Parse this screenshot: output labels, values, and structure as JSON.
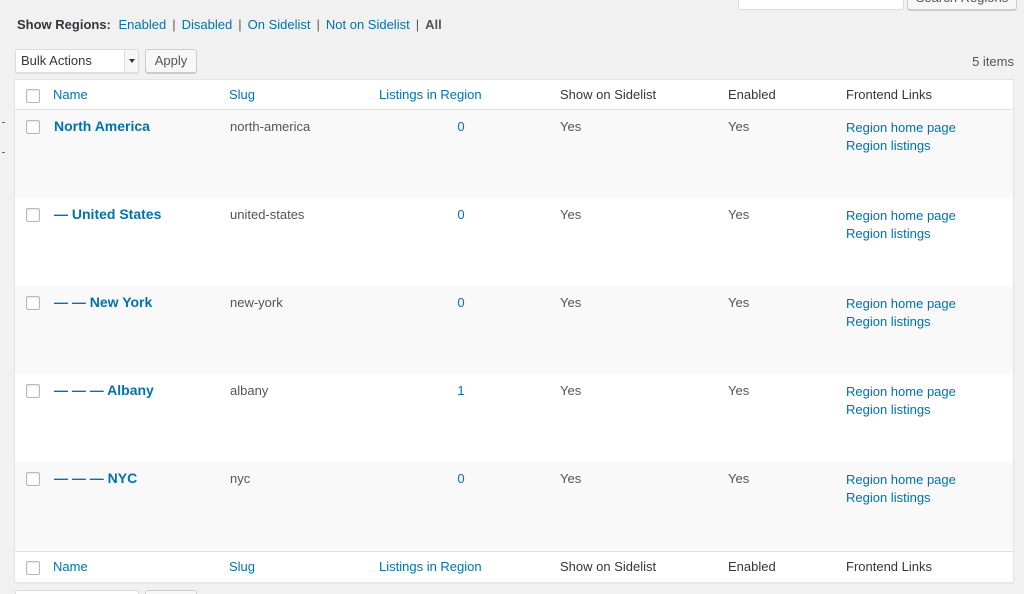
{
  "search": {
    "button_label": "Search Regions"
  },
  "filters": {
    "label": "Show Regions:",
    "enabled": "Enabled",
    "disabled": "Disabled",
    "on_sidelist": "On Sidelist",
    "not_on_sidelist": "Not on Sidelist",
    "all": "All",
    "separator": "|"
  },
  "bulk_actions": {
    "selected": "Bulk Actions",
    "apply_label": "Apply"
  },
  "items_count": "5 items",
  "columns": {
    "name": "Name",
    "slug": "Slug",
    "listings": "Listings in Region",
    "sidelist": "Show on Sidelist",
    "enabled": "Enabled",
    "links": "Frontend Links"
  },
  "rows": [
    {
      "name": "North America",
      "slug": "north-america",
      "count": "0",
      "sidelist": "Yes",
      "enabled": "Yes",
      "link_home": "Region home page",
      "link_listings": "Region listings"
    },
    {
      "name": "— United States",
      "slug": "united-states",
      "count": "0",
      "sidelist": "Yes",
      "enabled": "Yes",
      "link_home": "Region home page",
      "link_listings": "Region listings"
    },
    {
      "name": "— — New York",
      "slug": "new-york",
      "count": "0",
      "sidelist": "Yes",
      "enabled": "Yes",
      "link_home": "Region home page",
      "link_listings": "Region listings"
    },
    {
      "name": "— — — Albany",
      "slug": "albany",
      "count": "1",
      "sidelist": "Yes",
      "enabled": "Yes",
      "link_home": "Region home page",
      "link_listings": "Region listings"
    },
    {
      "name": "— — — NYC",
      "slug": "nyc",
      "count": "0",
      "sidelist": "Yes",
      "enabled": "Yes",
      "link_home": "Region home page",
      "link_listings": "Region listings"
    }
  ]
}
